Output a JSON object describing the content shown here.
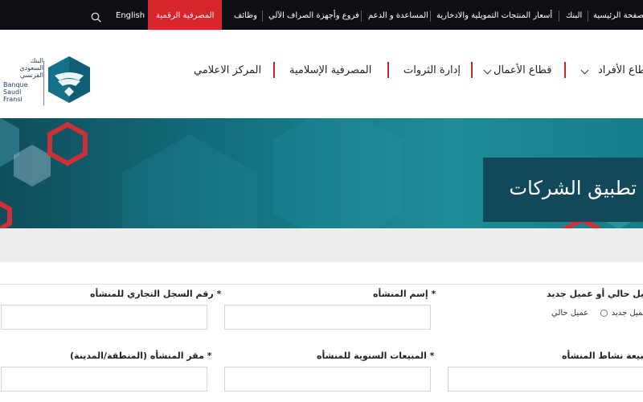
{
  "topbar": {
    "items": [
      "English",
      "المصرفية الرقمية",
      "وظائف",
      "فروع وأجهزة الصراف الآلي",
      "المساعدة و الدعم",
      "أسعار المنتجات التمويلية والادخارية",
      "البنك",
      "الصفحة الرئيسية"
    ],
    "search_icon": "search-icon",
    "digital_color": "#d7252c"
  },
  "logo": {
    "arabic": [
      "البنك",
      "السعودي",
      "الفرنسي"
    ],
    "latin": [
      "Banque",
      "Saudi",
      "Fransi"
    ]
  },
  "nav": {
    "items": [
      "قطاع الأفراد",
      "قطاع الأعمال",
      "إدارة الثروات",
      "المصرفية الإسلامية",
      "المركز الاعلامي"
    ],
    "separator_color": "#c9272e"
  },
  "hero": {
    "title": "تطبيق الشركات"
  },
  "form": {
    "customer_type_label": "عميل حالي أو عميل جديد *",
    "current_customer": "عميل حالي",
    "new_customer": "عميل جديد",
    "company_name_label": "إسم المنشأه *",
    "cr_number_label": "رقم السجل التجاري للمنشأه *",
    "activity_label": "طبيعة نشاط المنشأه *",
    "annual_sales_label": "المبيعات السنوية للمنشأه *",
    "location_label": "مقر المنشأه (المنطقة/المدينة) *"
  }
}
